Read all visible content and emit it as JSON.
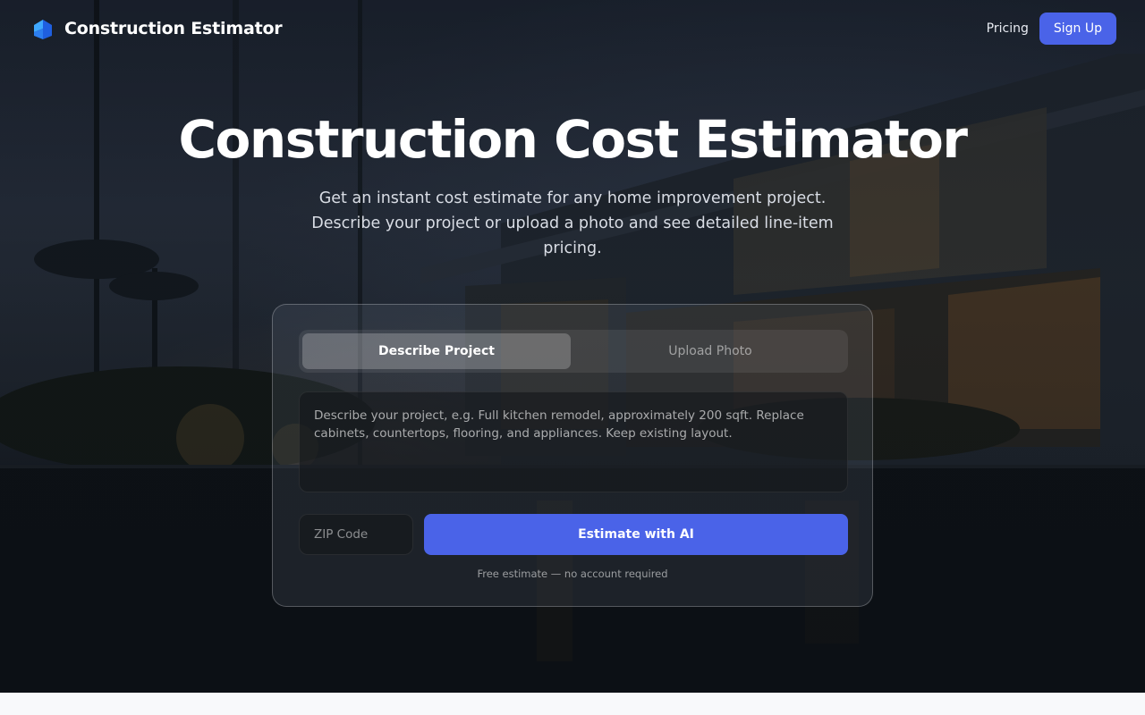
{
  "app": {
    "name": "Construction Estimator"
  },
  "nav": {
    "pricing_label": "Pricing",
    "signup_label": "Sign Up"
  },
  "hero": {
    "title": "Construction Cost Estimator",
    "subtitle": "Get an instant cost estimate for any home improvement project. Describe your project or upload a photo and see detailed line-item pricing."
  },
  "estimator": {
    "tabs": [
      {
        "label": "Describe Project",
        "active": true
      },
      {
        "label": "Upload Photo",
        "active": false
      }
    ],
    "description_placeholder": "Describe your project, e.g. Full kitchen remodel, approximately 200 sqft. Replace cabinets, countertops, flooring, and appliances. Keep existing layout.",
    "description_value": "",
    "zip_placeholder": "ZIP Code",
    "zip_value": "",
    "submit_label": "Estimate with AI",
    "footnote": "Free estimate — no account required"
  },
  "colors": {
    "accent": "#4a63e8",
    "logo_light": "#3fa9ff",
    "logo_dark": "#1f5fe0"
  },
  "icons": {
    "logo": "house-cube-icon"
  }
}
